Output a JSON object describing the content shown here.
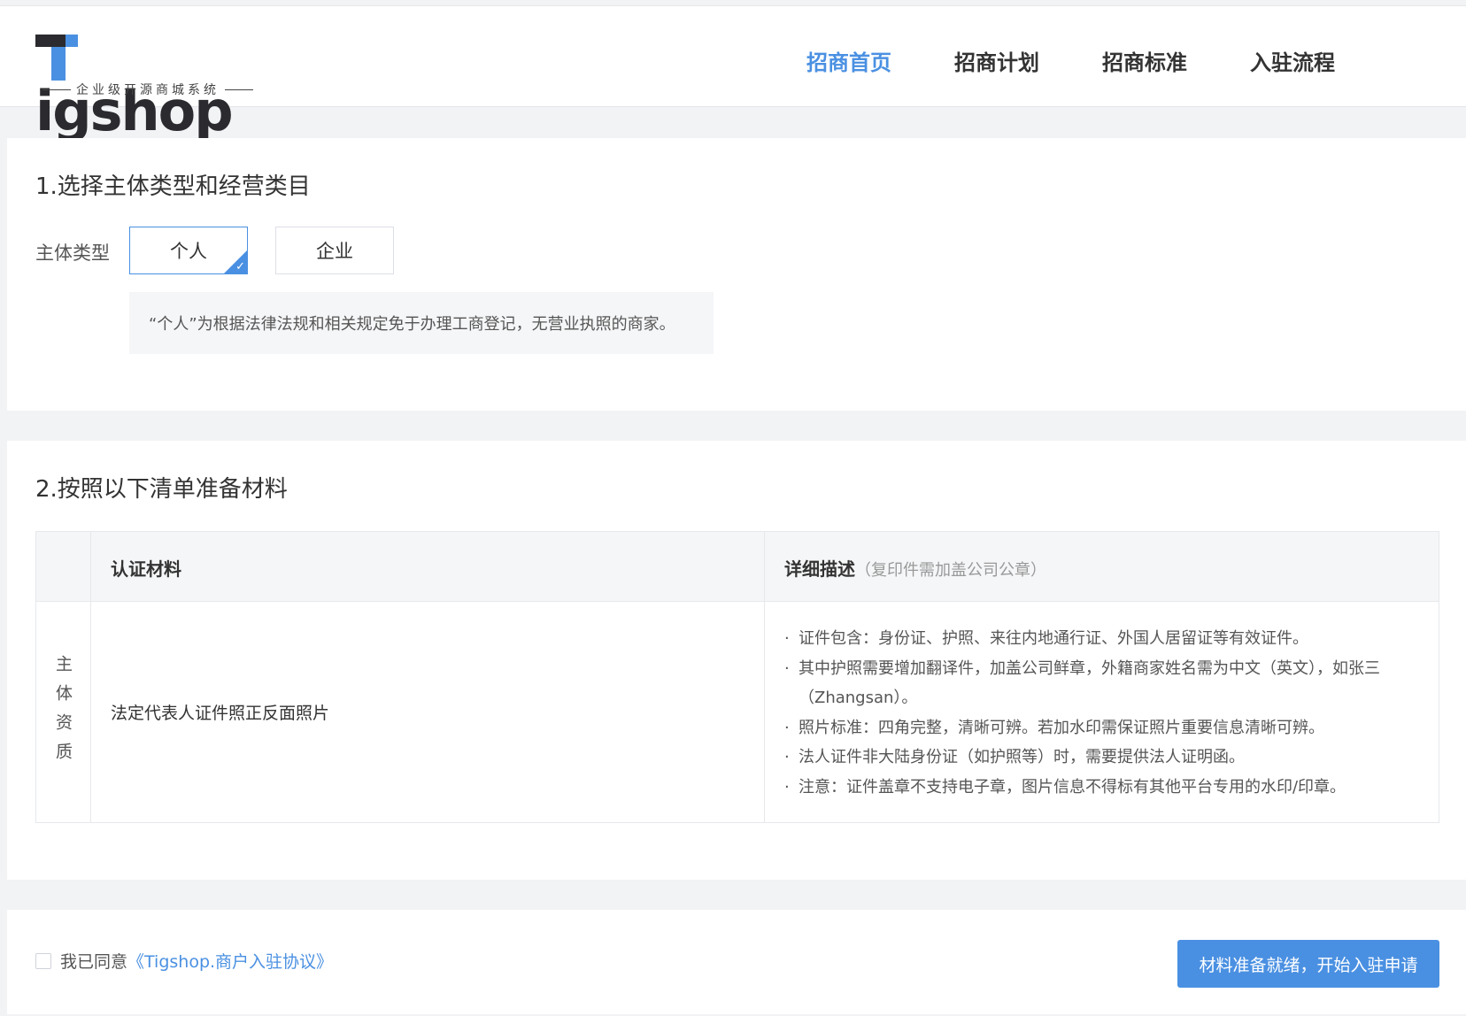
{
  "header": {
    "logo_word": "Tigshop",
    "logo_tagline": "企业级开源商城系统",
    "nav": [
      {
        "label": "招商首页",
        "active": true
      },
      {
        "label": "招商计划",
        "active": false
      },
      {
        "label": "招商标准",
        "active": false
      },
      {
        "label": "入驻流程",
        "active": false
      }
    ]
  },
  "step1": {
    "title": "1.选择主体类型和经营类目",
    "type_label": "主体类型",
    "options": [
      {
        "label": "个人",
        "selected": true
      },
      {
        "label": "企业",
        "selected": false
      }
    ],
    "hint": "“个人”为根据法律法规和相关规定免于办理工商登记，无营业执照的商家。"
  },
  "step2": {
    "title": "2.按照以下清单准备材料",
    "table": {
      "col_material": "认证材料",
      "col_desc": "详细描述",
      "col_desc_note": "（复印件需加盖公司公章）",
      "rows": [
        {
          "category": "主体资质",
          "material": "法定代表人证件照正反面照片",
          "desc": [
            "证件包含：身份证、护照、来往内地通行证、外国人居留证等有效证件。",
            "其中护照需要增加翻译件，加盖公司鲜章，外籍商家姓名需为中文（英文），如张三（Zhangsan）。",
            "照片标准：四角完整，清晰可辨。若加水印需保证照片重要信息清晰可辨。",
            "法人证件非大陆身份证（如护照等）时，需要提供法人证明函。",
            "注意：证件盖章不支持电子章，图片信息不得标有其他平台专用的水印/印章。"
          ]
        }
      ]
    }
  },
  "footer": {
    "agree_prefix": "我已同意",
    "agree_link": "《Tigshop.商户入驻协议》",
    "agree_checked": false,
    "submit_label": "材料准备就绪，开始入驻申请"
  },
  "colors": {
    "accent": "#4a90e2",
    "logo_dark": "#2b2b2f",
    "page_bg": "#f2f3f5"
  }
}
